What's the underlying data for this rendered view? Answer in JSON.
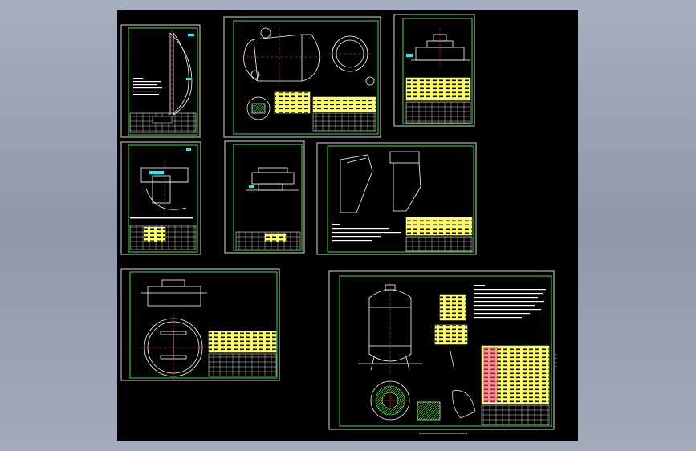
{
  "canvas": {
    "background": "#000000"
  },
  "colors": {
    "sheet_frame": "#d8d8d8",
    "inner_border": "#3fe03f",
    "geometry": "#ffffff",
    "centerline": "#ff3b3b",
    "dimension": "#00ffff",
    "table_fill": "#ffff66",
    "hatch": "#33ff33",
    "highlight": "#ff33aa"
  },
  "sheets": [
    {
      "id": "sheet-1",
      "kind": "vessel-head"
    },
    {
      "id": "sheet-2",
      "kind": "horizontal-vessel"
    },
    {
      "id": "sheet-3",
      "kind": "flange-assembly"
    },
    {
      "id": "sheet-4",
      "kind": "saddle-support"
    },
    {
      "id": "sheet-5",
      "kind": "nozzle-detail"
    },
    {
      "id": "sheet-6",
      "kind": "support-legs"
    },
    {
      "id": "sheet-7",
      "kind": "manhole-cover"
    },
    {
      "id": "sheet-8",
      "kind": "vertical-tank-assembly"
    }
  ],
  "sheet8": {
    "side_note_lines": [
      "…",
      "…",
      "…",
      "…"
    ]
  }
}
